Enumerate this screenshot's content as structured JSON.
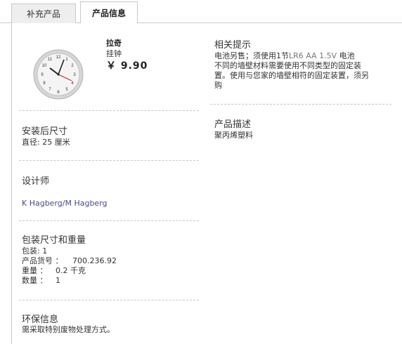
{
  "tabs": [
    {
      "label": "补充产品",
      "active": false
    },
    {
      "label": "产品信息",
      "active": true
    }
  ],
  "product": {
    "name": "拉奇",
    "type": "挂钟",
    "price": "￥ 9.90"
  },
  "dimensions": {
    "title": "安装后尺寸",
    "diameter": "直径: 25 厘米"
  },
  "designer": {
    "title": "设计师",
    "name": "K Hagberg/M Hagberg"
  },
  "package": {
    "title": "包装尺寸和重量",
    "count": "包装: 1",
    "article_label": "产品货号 ：",
    "article_value": "700.236.92",
    "weight_label": "重量 ：",
    "weight_value": "0.2 千克",
    "qty_label": "数量 ：",
    "qty_value": "1"
  },
  "environment": {
    "title": "环保信息",
    "text": "需采取特别废物处理方式。"
  },
  "tips": {
    "title": "相关提示",
    "line1_a": "电池另售；须使用1节",
    "line1_b": "LR6 AA 1.5V",
    "line1_c": " 电池",
    "line2": "不同的墙壁材料需要使用不同类型的固定装",
    "line3": "置。使用与您家的墙壁相符的固定装置，须另",
    "line4": "购"
  },
  "description": {
    "title": "产品描述",
    "text": "聚丙烯塑料"
  },
  "colors": {
    "tab_active_bg": "#ffffff",
    "tab_inactive_bg": "#eeeeee",
    "border": "#c9c9c9",
    "link": "#4a4a8a",
    "clock_hand_red": "#cc2222"
  }
}
